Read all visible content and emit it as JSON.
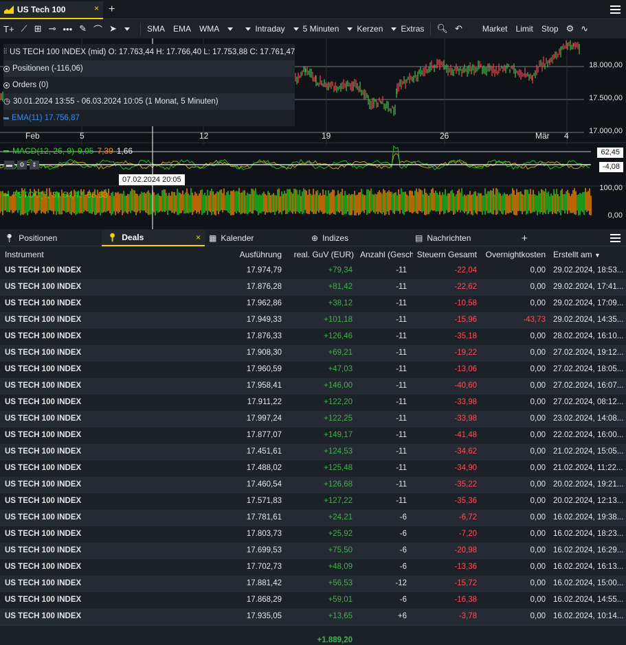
{
  "window_tab": {
    "title": "US Tech 100",
    "close": "×",
    "add": "+"
  },
  "toolbar": {
    "indicators": [
      "SMA",
      "EMA",
      "WMA"
    ],
    "interval": "Intraday",
    "period": "5 Minuten",
    "chart_type": "Kerzen",
    "extras": "Extras",
    "orders": [
      "Market",
      "Limit",
      "Stop"
    ]
  },
  "chart": {
    "ohlc_line": "US TECH 100 INDEX (mid)  O: 17.763,44  H: 17.766,40  L: 17.753,88  C: 17.761,47",
    "positions": "Positionen (-116,06)",
    "orders": "Orders (0)",
    "range": "30.01.2024 13:55 - 06.03.2024 10:05   (1 Monat, 5 Minuten)",
    "ema": "EMA(11) 17.756,87",
    "price_labels": [
      "18.000,00",
      "17.500,00",
      "17.000,00"
    ],
    "x_labels": [
      "Feb",
      "5",
      "12",
      "19",
      "26",
      "Mär",
      "4"
    ],
    "macd": {
      "label": "MACD(12, 26, 9)",
      "v1": "9,05",
      "v2": "7,39",
      "v3": "1,66",
      "tag_high": "62,45",
      "tag_low": "-4,08"
    },
    "fstoc": {
      "label": "FSTOC(5, 3)",
      "v1": "54,47",
      "v2": "66,33",
      "axis_top": "100,00",
      "axis_bottom": "0,00"
    },
    "cursor_date": "07.02.2024 20:05",
    "colors": {
      "up": "#3fb24a",
      "down": "#e0454f",
      "ema": "#2f8ff0",
      "stoch_k": "#20d320",
      "stoch_d": "#ff8a00"
    }
  },
  "panel_tabs": [
    {
      "label": "Positionen",
      "icon": "pin-icon"
    },
    {
      "label": "Deals",
      "icon": "pin-icon",
      "active": true
    },
    {
      "label": "Kalender",
      "icon": "calendar-icon"
    },
    {
      "label": "Indizes",
      "icon": "globe-icon"
    },
    {
      "label": "Nachrichten",
      "icon": "news-icon"
    }
  ],
  "panel_add": "+",
  "table": {
    "headers": [
      "Instrument",
      "Ausführung",
      "real. GuV (EUR)",
      "Anzahl (Geschl",
      "Steuern Gesamt",
      "Overnightkosten",
      "Erstellt am"
    ],
    "rows": [
      [
        "US TECH 100 INDEX",
        "17.974,79",
        "+79,34",
        "-11",
        "-22,04",
        "0,00",
        "29.02.2024, 18:53..."
      ],
      [
        "US TECH 100 INDEX",
        "17.876,28",
        "+81,42",
        "-11",
        "-22,62",
        "0,00",
        "29.02.2024, 17:41..."
      ],
      [
        "US TECH 100 INDEX",
        "17.962,86",
        "+38,12",
        "-11",
        "-10,58",
        "0,00",
        "29.02.2024, 17:09..."
      ],
      [
        "US TECH 100 INDEX",
        "17.949,33",
        "+101,18",
        "-11",
        "-15,96",
        "-43,73",
        "29.02.2024, 14:35..."
      ],
      [
        "US TECH 100 INDEX",
        "17.876,33",
        "+126,46",
        "-11",
        "-35,18",
        "0,00",
        "28.02.2024, 16:10..."
      ],
      [
        "US TECH 100 INDEX",
        "17.908,30",
        "+69,21",
        "-11",
        "-19,22",
        "0,00",
        "27.02.2024, 19:12..."
      ],
      [
        "US TECH 100 INDEX",
        "17.960,59",
        "+47,03",
        "-11",
        "-13,06",
        "0,00",
        "27.02.2024, 18:05..."
      ],
      [
        "US TECH 100 INDEX",
        "17.958,41",
        "+146,00",
        "-11",
        "-40,60",
        "0,00",
        "27.02.2024, 16:07..."
      ],
      [
        "US TECH 100 INDEX",
        "17.911,22",
        "+122,20",
        "-11",
        "-33,98",
        "0,00",
        "27.02.2024, 08:12..."
      ],
      [
        "US TECH 100 INDEX",
        "17.997,24",
        "+122,25",
        "-11",
        "-33,98",
        "0,00",
        "23.02.2024, 14:08..."
      ],
      [
        "US TECH 100 INDEX",
        "17.877,07",
        "+149,17",
        "-11",
        "-41,48",
        "0,00",
        "22.02.2024, 16:00..."
      ],
      [
        "US TECH 100 INDEX",
        "17.451,61",
        "+124,53",
        "-11",
        "-34,62",
        "0,00",
        "21.02.2024, 15:05..."
      ],
      [
        "US TECH 100 INDEX",
        "17.488,02",
        "+125,48",
        "-11",
        "-34,90",
        "0,00",
        "21.02.2024, 11:22..."
      ],
      [
        "US TECH 100 INDEX",
        "17.460,54",
        "+126,68",
        "-11",
        "-35,22",
        "0,00",
        "20.02.2024, 19:21..."
      ],
      [
        "US TECH 100 INDEX",
        "17.571,83",
        "+127,22",
        "-11",
        "-35,36",
        "0,00",
        "20.02.2024, 12:13..."
      ],
      [
        "US TECH 100 INDEX",
        "17.781,61",
        "+24,21",
        "-6",
        "-6,72",
        "0,00",
        "16.02.2024, 19:38..."
      ],
      [
        "US TECH 100 INDEX",
        "17.803,73",
        "+25,92",
        "-6",
        "-7,20",
        "0,00",
        "16.02.2024, 18:23..."
      ],
      [
        "US TECH 100 INDEX",
        "17.699,53",
        "+75,50",
        "-6",
        "-20,98",
        "0,00",
        "16.02.2024, 16:29..."
      ],
      [
        "US TECH 100 INDEX",
        "17.702,73",
        "+48,09",
        "-6",
        "-13,36",
        "0,00",
        "16.02.2024, 16:13..."
      ],
      [
        "US TECH 100 INDEX",
        "17.881,42",
        "+56,53",
        "-12",
        "-15,72",
        "0,00",
        "16.02.2024, 15:00..."
      ],
      [
        "US TECH 100 INDEX",
        "17.868,29",
        "+59,01",
        "-6",
        "-16,38",
        "0,00",
        "16.02.2024, 14:55..."
      ],
      [
        "US TECH 100 INDEX",
        "17.935,05",
        "+13,65",
        "+6",
        "-3,78",
        "0,00",
        "16.02.2024, 10:14..."
      ]
    ],
    "total": "+1.889,20"
  }
}
